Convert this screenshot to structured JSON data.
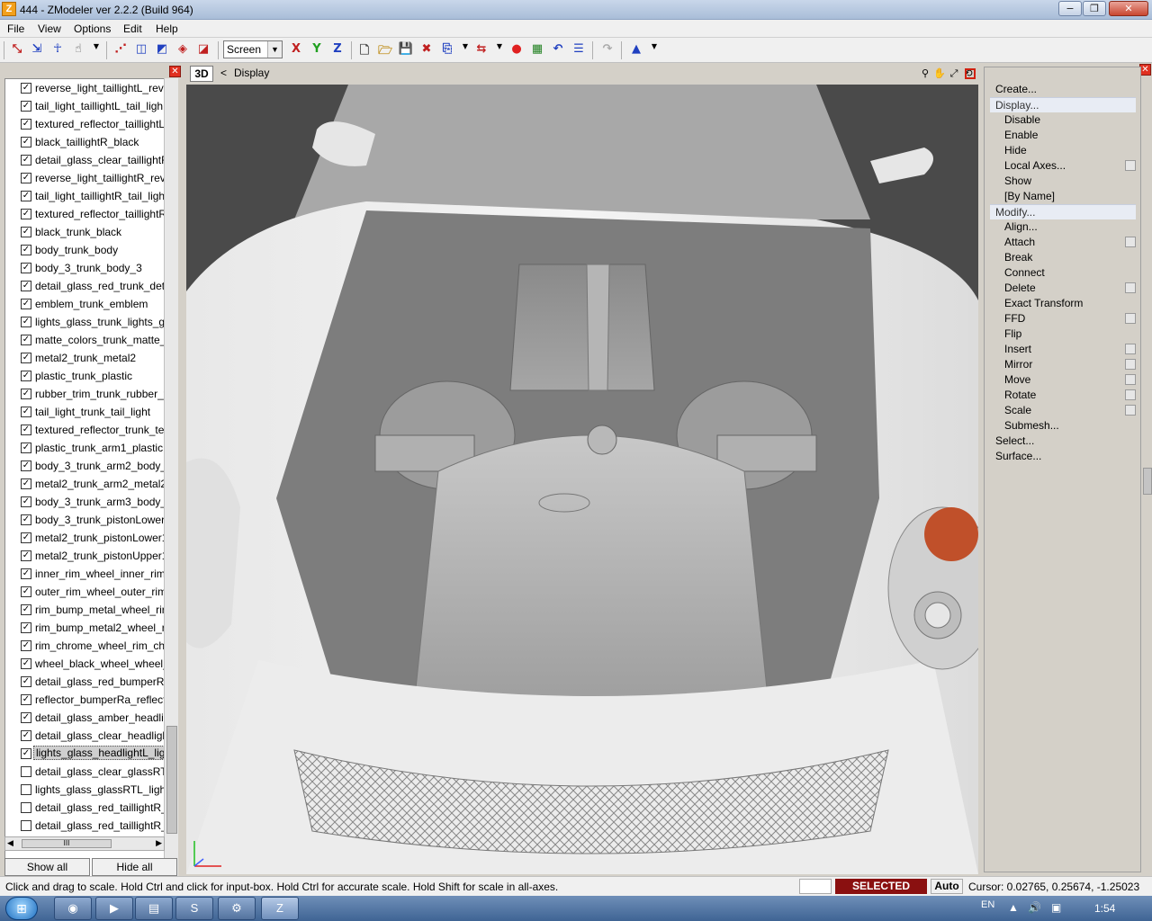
{
  "window": {
    "title": "444 - ZModeler ver 2.2.2 (Build 964)",
    "icon_letter": "Z",
    "minimize": "−",
    "restore": "❐",
    "close": "✕"
  },
  "menu": [
    "File",
    "View",
    "Options",
    "Edit",
    "Help"
  ],
  "toolbar": {
    "mode_select_value": "Screen",
    "axis_x": "X",
    "axis_y": "Y",
    "axis_z": "Z"
  },
  "left_panel": {
    "items": [
      {
        "label": "reverse_light_taillightL_reve",
        "checked": true
      },
      {
        "label": "tail_light_taillightL_tail_ligh",
        "checked": true
      },
      {
        "label": "textured_reflector_taillightL",
        "checked": true
      },
      {
        "label": "black_taillightR_black",
        "checked": true
      },
      {
        "label": "detail_glass_clear_taillightR",
        "checked": true
      },
      {
        "label": "reverse_light_taillightR_reve",
        "checked": true
      },
      {
        "label": "tail_light_taillightR_tail_ligh",
        "checked": true
      },
      {
        "label": "textured_reflector_taillightR",
        "checked": true
      },
      {
        "label": "black_trunk_black",
        "checked": true
      },
      {
        "label": "body_trunk_body",
        "checked": true
      },
      {
        "label": "body_3_trunk_body_3",
        "checked": true
      },
      {
        "label": "detail_glass_red_trunk_deta",
        "checked": true
      },
      {
        "label": "emblem_trunk_emblem",
        "checked": true
      },
      {
        "label": "lights_glass_trunk_lights_gl",
        "checked": true
      },
      {
        "label": "matte_colors_trunk_matte_",
        "checked": true
      },
      {
        "label": "metal2_trunk_metal2",
        "checked": true
      },
      {
        "label": "plastic_trunk_plastic",
        "checked": true
      },
      {
        "label": "rubber_trim_trunk_rubber_t",
        "checked": true
      },
      {
        "label": "tail_light_trunk_tail_light",
        "checked": true
      },
      {
        "label": "textured_reflector_trunk_tex",
        "checked": true
      },
      {
        "label": "plastic_trunk_arm1_plastic",
        "checked": true
      },
      {
        "label": "body_3_trunk_arm2_body_3",
        "checked": true
      },
      {
        "label": "metal2_trunk_arm2_metal2",
        "checked": true
      },
      {
        "label": "body_3_trunk_arm3_body_3",
        "checked": true
      },
      {
        "label": "body_3_trunk_pistonLower1",
        "checked": true
      },
      {
        "label": "metal2_trunk_pistonLower1",
        "checked": true
      },
      {
        "label": "metal2_trunk_pistonUpper1",
        "checked": true
      },
      {
        "label": "inner_rim_wheel_inner_rim",
        "checked": true
      },
      {
        "label": "outer_rim_wheel_outer_rim",
        "checked": true
      },
      {
        "label": "rim_bump_metal_wheel_rir",
        "checked": true
      },
      {
        "label": "rim_bump_metal2_wheel_ri",
        "checked": true
      },
      {
        "label": "rim_chrome_wheel_rim_chr",
        "checked": true
      },
      {
        "label": "wheel_black_wheel_wheel_l",
        "checked": true
      },
      {
        "label": "detail_glass_red_bumperRa",
        "checked": true
      },
      {
        "label": "reflector_bumperRa_reflect",
        "checked": true
      },
      {
        "label": "detail_glass_amber_headlig",
        "checked": true
      },
      {
        "label": "detail_glass_clear_headlight",
        "checked": true
      },
      {
        "label": "lights_glass_headlightL_ligh",
        "checked": true,
        "selected": true
      },
      {
        "label": "detail_glass_clear_glassRTL",
        "checked": false
      },
      {
        "label": "lights_glass_glassRTL_lights",
        "checked": false
      },
      {
        "label": "detail_glass_red_taillightR_c",
        "checked": false
      },
      {
        "label": "detail_glass_red_taillightR_c",
        "checked": false
      }
    ],
    "hscroll_thumb": "III",
    "show_all": "Show all",
    "hide_all": "Hide all"
  },
  "viewport": {
    "tab": "3D",
    "back": "<",
    "title": "Display"
  },
  "right_panel": {
    "items": [
      {
        "label": "Create...",
        "type": "top"
      },
      {
        "label": "Display...",
        "type": "head"
      },
      {
        "label": "Disable",
        "type": "sub"
      },
      {
        "label": "Enable",
        "type": "sub"
      },
      {
        "label": "Hide",
        "type": "sub"
      },
      {
        "label": "Local Axes...",
        "type": "sub",
        "box": true
      },
      {
        "label": "Show",
        "type": "sub"
      },
      {
        "label": "[By Name]",
        "type": "sub"
      },
      {
        "label": "Modify...",
        "type": "head"
      },
      {
        "label": "Align...",
        "type": "sub"
      },
      {
        "label": "Attach",
        "type": "sub",
        "box": true
      },
      {
        "label": "Break",
        "type": "sub"
      },
      {
        "label": "Connect",
        "type": "sub"
      },
      {
        "label": "Delete",
        "type": "sub",
        "box": true
      },
      {
        "label": "Exact Transform",
        "type": "sub"
      },
      {
        "label": "FFD",
        "type": "sub",
        "box": true
      },
      {
        "label": "Flip",
        "type": "sub"
      },
      {
        "label": "Insert",
        "type": "sub",
        "box": true
      },
      {
        "label": "Mirror",
        "type": "sub",
        "box": true
      },
      {
        "label": "Move",
        "type": "sub",
        "box": true
      },
      {
        "label": "Rotate",
        "type": "sub",
        "box": true
      },
      {
        "label": "Scale",
        "type": "sub",
        "box": true
      },
      {
        "label": "Submesh...",
        "type": "sub"
      },
      {
        "label": "Select...",
        "type": "top"
      },
      {
        "label": "Surface...",
        "type": "top"
      }
    ]
  },
  "status": {
    "hint": "Click and drag to scale. Hold Ctrl and click for input-box. Hold Ctrl for accurate scale. Hold Shift for scale in all-axes.",
    "mode": "SELECTED MODE",
    "auto": "Auto",
    "cursor": "Cursor: 0.02765, 0.25674, -1.25023"
  },
  "taskbar": {
    "lang": "EN",
    "time": "1:54"
  }
}
